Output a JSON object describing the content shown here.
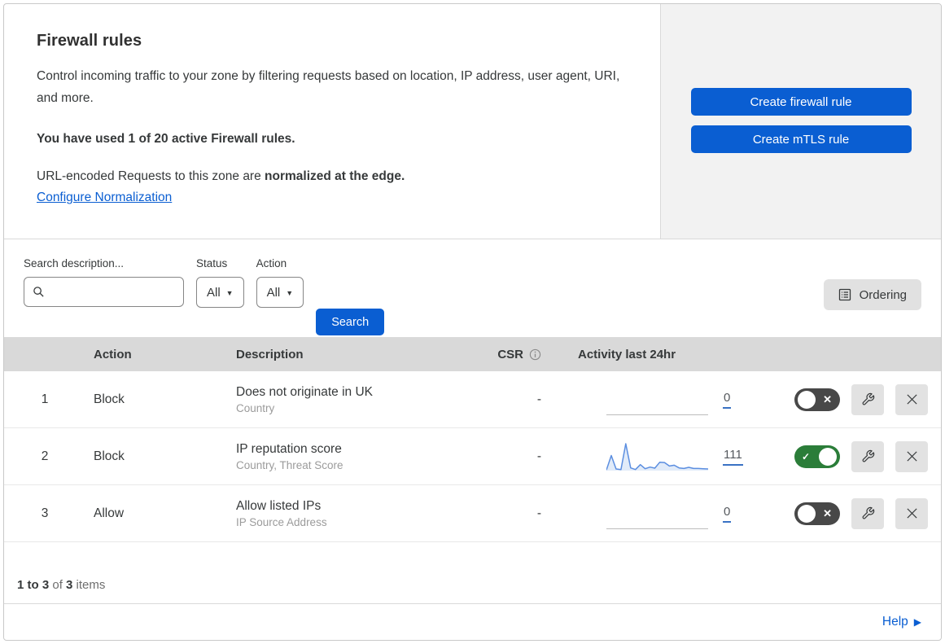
{
  "header": {
    "title": "Firewall rules",
    "description": "Control incoming traffic to your zone by filtering requests based on location, IP address, user agent, URI, and more.",
    "usage_note": "You have used 1 of 20 active Firewall rules.",
    "normalization_prefix": "URL-encoded Requests to this zone are ",
    "normalization_bold": "normalized at the edge.",
    "normalization_link": "Configure Normalization",
    "buttons": {
      "create_firewall_rule": "Create firewall rule",
      "create_mtls_rule": "Create mTLS rule"
    }
  },
  "filters": {
    "search_label": "Search description...",
    "search_placeholder": "",
    "status_label": "Status",
    "status_value": "All",
    "action_label": "Action",
    "action_value": "All",
    "search_button": "Search",
    "ordering_button": "Ordering"
  },
  "table": {
    "columns": {
      "action": "Action",
      "description": "Description",
      "csr": "CSR",
      "activity": "Activity last 24hr"
    },
    "rows": [
      {
        "priority": "1",
        "action": "Block",
        "description": "Does not originate in UK",
        "fields": "Country",
        "csr": "-",
        "activity_count": "0",
        "enabled": false
      },
      {
        "priority": "2",
        "action": "Block",
        "description": "IP reputation score",
        "fields": "Country, Threat Score",
        "csr": "-",
        "activity_count": "111",
        "enabled": true
      },
      {
        "priority": "3",
        "action": "Allow",
        "description": "Allow listed IPs",
        "fields": "IP Source Address",
        "csr": "-",
        "activity_count": "0",
        "enabled": false
      }
    ]
  },
  "footer": {
    "range": "1 to 3",
    "of": " of ",
    "total": "3",
    "items": " items",
    "help": "Help"
  },
  "colors": {
    "accent_blue": "#0a5ed2",
    "toggle_on_green": "#2b7d39",
    "toggle_off_gray": "#484848",
    "table_header_bg": "#d9d9d9",
    "panel_bg": "#f2f2f2",
    "sparkline_stroke": "#5b8ee0"
  },
  "chart_data": {
    "type": "line",
    "title": "Activity last 24hr (rule 2 sparkline)",
    "x": [
      0,
      1,
      2,
      3,
      4,
      5,
      6,
      7,
      8,
      9,
      10,
      11,
      12,
      13,
      14,
      15,
      16,
      17,
      18,
      19,
      20,
      21
    ],
    "values": [
      2,
      56,
      6,
      4,
      100,
      10,
      4,
      22,
      7,
      13,
      9,
      31,
      30,
      17,
      20,
      10,
      8,
      12,
      8,
      8,
      7,
      6
    ],
    "ylim": [
      0,
      100
    ],
    "total_requests": 111,
    "grid": false,
    "legend": "none"
  }
}
